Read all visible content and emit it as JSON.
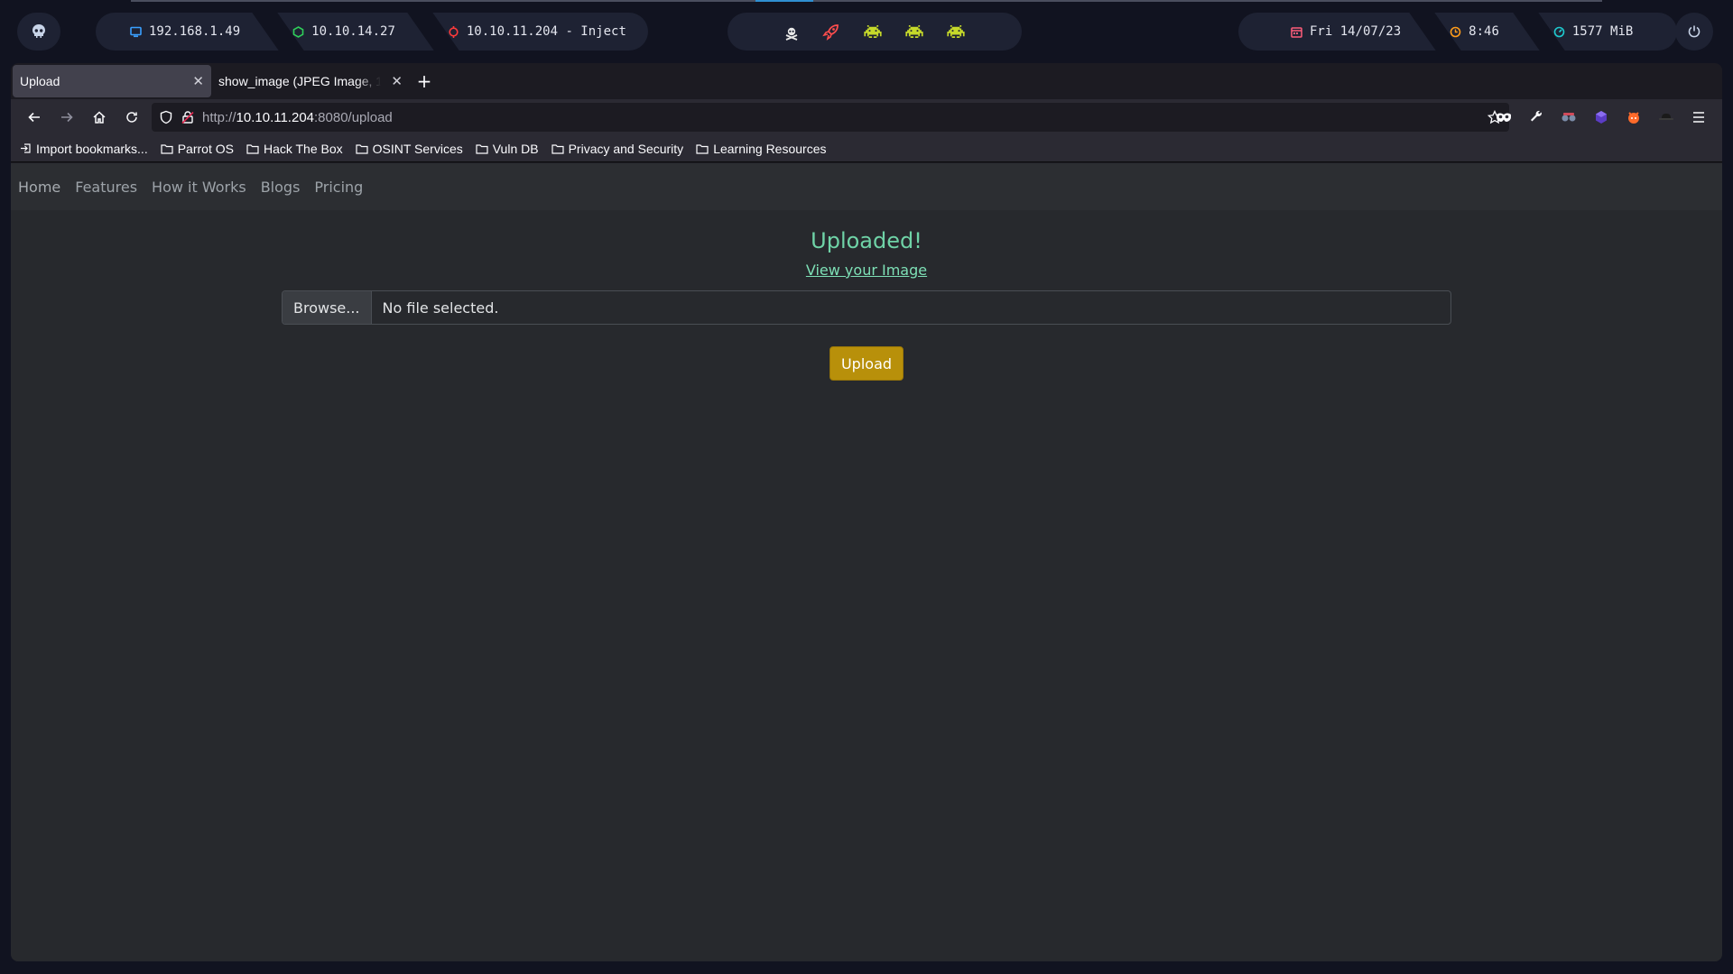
{
  "topbar": {
    "ips": [
      {
        "label": "192.168.1.49",
        "icon": "monitor-icon",
        "color": "#3aa0ff"
      },
      {
        "label": "10.10.14.27",
        "icon": "vpn-shield-icon",
        "color": "#2fd05a"
      },
      {
        "label": "10.10.11.204 - Inject",
        "icon": "target-icon",
        "color": "#ff3b3b"
      }
    ],
    "workspace_icons": [
      {
        "icon": "skull-crossbones-icon",
        "color": "#e8e8e8"
      },
      {
        "icon": "rocket-icon",
        "color": "#ff4d4d"
      },
      {
        "icon": "space-invader-icon",
        "color": "#c5d92a"
      },
      {
        "icon": "space-invader-icon",
        "color": "#c5d92a"
      },
      {
        "icon": "space-invader-icon",
        "color": "#c5d92a"
      }
    ],
    "date": "Fri 14/07/23",
    "time": "8:46",
    "memory": "1577 MiB"
  },
  "browser": {
    "tabs": [
      {
        "title": "Upload",
        "active": true
      },
      {
        "title": "show_image (JPEG Image, 1",
        "active": false
      }
    ],
    "url_prefix": "http://",
    "url_host": "10.10.11.204",
    "url_rest": ":8080/upload",
    "bookmarks": [
      {
        "label": "Import bookmarks...",
        "icon": "import-icon"
      },
      {
        "label": "Parrot OS",
        "icon": "folder-icon"
      },
      {
        "label": "Hack The Box",
        "icon": "folder-icon"
      },
      {
        "label": "OSINT Services",
        "icon": "folder-icon"
      },
      {
        "label": "Vuln DB",
        "icon": "folder-icon"
      },
      {
        "label": "Privacy and Security",
        "icon": "folder-icon"
      },
      {
        "label": "Learning Resources",
        "icon": "folder-icon"
      }
    ]
  },
  "page": {
    "nav": [
      "Home",
      "Features",
      "How it Works",
      "Blogs",
      "Pricing"
    ],
    "status": "Uploaded!",
    "view_link": "View your Image",
    "browse_label": "Browse...",
    "file_status": "No file selected.",
    "upload_label": "Upload",
    "colors": {
      "success": "#6fd3a7",
      "upload_button": "#b8900a"
    }
  }
}
